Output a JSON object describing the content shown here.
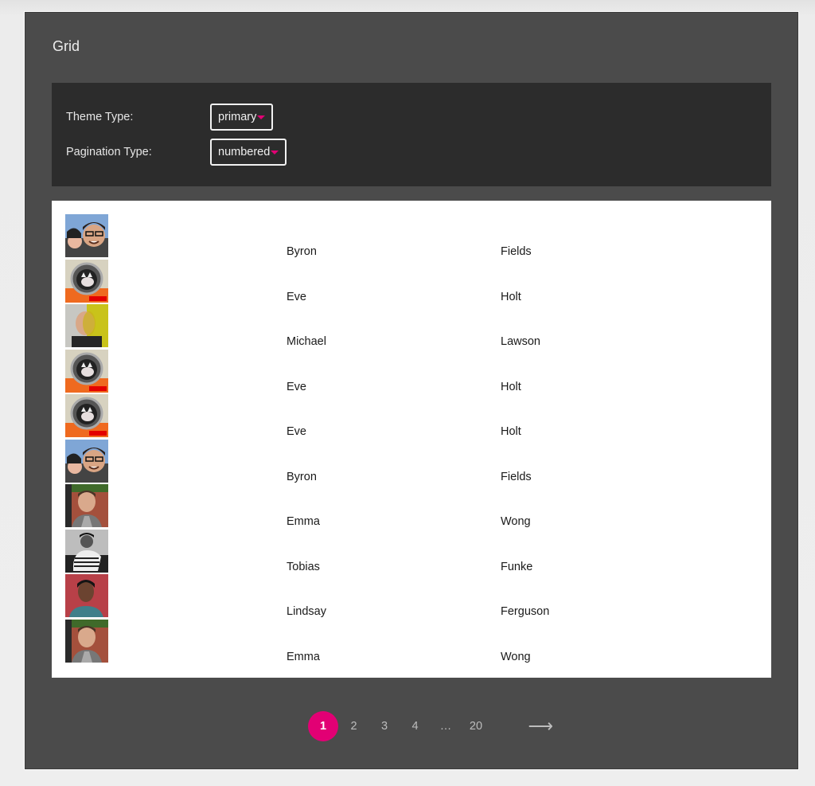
{
  "page": {
    "title": "Grid"
  },
  "settings": {
    "theme_type": {
      "label": "Theme Type:",
      "value": "primary"
    },
    "pagination_type": {
      "label": "Pagination Type:",
      "value": "numbered"
    }
  },
  "colors": {
    "accent": "#e20074",
    "panel_bg": "#4b4b4b",
    "settings_bg": "#2c2c2c",
    "grid_bg": "#ffffff"
  },
  "grid": {
    "rows": [
      {
        "avatar": "photo-man-glasses-kiss",
        "first": "Byron",
        "last": "Fields"
      },
      {
        "avatar": "photo-cat-astronaut",
        "first": "Eve",
        "last": "Holt"
      },
      {
        "avatar": "photo-man-yellow-split",
        "first": "Michael",
        "last": "Lawson"
      },
      {
        "avatar": "photo-cat-astronaut",
        "first": "Eve",
        "last": "Holt"
      },
      {
        "avatar": "photo-cat-astronaut",
        "first": "Eve",
        "last": "Holt"
      },
      {
        "avatar": "photo-man-glasses-kiss",
        "first": "Byron",
        "last": "Fields"
      },
      {
        "avatar": "photo-man-brick-wall",
        "first": "Emma",
        "last": "Wong"
      },
      {
        "avatar": "photo-man-striped-bw",
        "first": "Tobias",
        "last": "Funke"
      },
      {
        "avatar": "photo-man-red-wall",
        "first": "Lindsay",
        "last": "Ferguson"
      },
      {
        "avatar": "photo-man-brick-wall",
        "first": "Emma",
        "last": "Wong"
      }
    ]
  },
  "pagination": {
    "pages": [
      "1",
      "2",
      "3",
      "4"
    ],
    "ellipsis": "…",
    "last_page": "20",
    "current": "1",
    "next_icon": "arrow-right-icon",
    "next_glyph": "⟶"
  }
}
